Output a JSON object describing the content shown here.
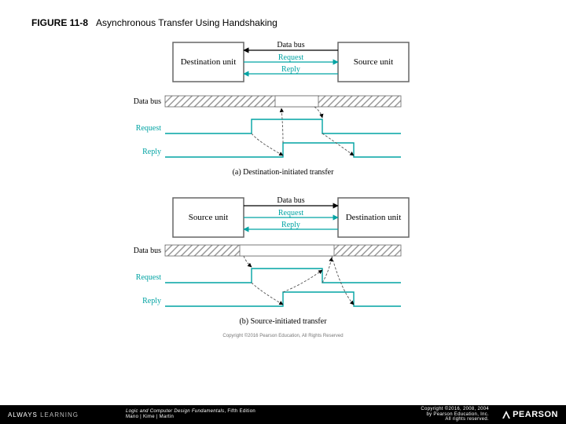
{
  "header": {
    "figure_number": "FIGURE 11-8",
    "figure_title": "Asynchronous Transfer Using Handshaking"
  },
  "diagram": {
    "top": {
      "left_unit": "Destination unit",
      "right_unit": "Source unit",
      "bus_label_top": "Data bus",
      "bus_label_req": "Request",
      "bus_label_rep": "Reply",
      "timing": {
        "databus_label": "Data bus",
        "request_label": "Request",
        "reply_label": "Reply"
      },
      "caption": "(a) Destination-initiated transfer"
    },
    "bottom": {
      "left_unit": "Source unit",
      "right_unit": "Destination unit",
      "bus_label_top": "Data bus",
      "bus_label_req": "Request",
      "bus_label_rep": "Reply",
      "timing": {
        "databus_label": "Data bus",
        "request_label": "Request",
        "reply_label": "Reply"
      },
      "caption": "(b) Source-initiated transfer"
    },
    "inner_copyright": "Copyright ©2016 Pearson Education, All Rights Reserved"
  },
  "footer": {
    "always_learning": "ALWAYS LEARNING",
    "book_title": "Logic and Computer Design Fundamentals",
    "edition": ", Fifth Edition",
    "authors": "Mano | Kime | Martin",
    "copyright_line1": "Copyright ©2016, 2008, 2004",
    "copyright_line2": "by Pearson Education, Inc.",
    "copyright_line3": "All rights reserved.",
    "brand": "PEARSON"
  },
  "colors": {
    "teal": "#00a3a3",
    "grey_box": "#7a7a7a",
    "hatch": "#9a9a9a"
  }
}
